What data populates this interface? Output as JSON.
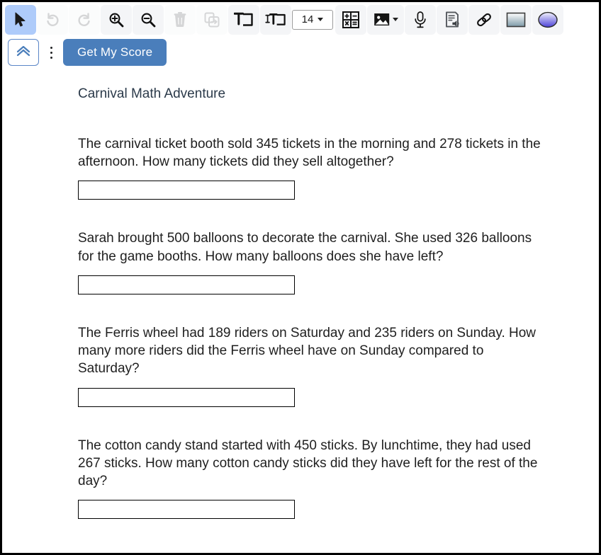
{
  "toolbar": {
    "buttons": [
      {
        "name": "select-tool",
        "icon": "cursor-arrow-icon",
        "label": "Select",
        "state": "active"
      },
      {
        "name": "undo-button",
        "icon": "undo-icon",
        "label": "Undo",
        "state": "disabled"
      },
      {
        "name": "redo-button",
        "icon": "redo-icon",
        "label": "Redo",
        "state": "disabled"
      },
      {
        "name": "zoom-in-button",
        "icon": "zoom-in-icon",
        "label": "Zoom In",
        "state": "enabled"
      },
      {
        "name": "zoom-out-button",
        "icon": "zoom-out-icon",
        "label": "Zoom Out",
        "state": "enabled"
      },
      {
        "name": "delete-button",
        "icon": "trash-icon",
        "label": "Delete",
        "state": "disabled"
      },
      {
        "name": "duplicate-button",
        "icon": "duplicate-icon",
        "label": "Duplicate",
        "state": "disabled"
      },
      {
        "name": "add-text-button",
        "icon": "text-box-icon",
        "label": "Add Text",
        "state": "enabled"
      },
      {
        "name": "text-style-button",
        "icon": "text-format-icon",
        "label": "Text Format",
        "state": "enabled"
      }
    ],
    "font_size_value": "14",
    "buttons_right": [
      {
        "name": "math-tool-button",
        "icon": "calculator-icon",
        "label": "Math",
        "state": "enabled"
      },
      {
        "name": "insert-image-button",
        "icon": "image-icon",
        "label": "Insert Image",
        "state": "enabled"
      },
      {
        "name": "microphone-button",
        "icon": "microphone-icon",
        "label": "Record Audio",
        "state": "enabled"
      },
      {
        "name": "read-aloud-button",
        "icon": "read-aloud-icon",
        "label": "Read Aloud",
        "state": "enabled"
      },
      {
        "name": "link-button",
        "icon": "link-icon",
        "label": "Insert Link",
        "state": "enabled"
      },
      {
        "name": "shape-rect-button",
        "icon": "rectangle-shape-icon",
        "label": "Rectangle",
        "state": "enabled"
      },
      {
        "name": "shape-ellipse-button",
        "icon": "ellipse-shape-icon",
        "label": "Ellipse",
        "state": "enabled"
      }
    ]
  },
  "subbar": {
    "collapse_icon": "double-chevron-up-icon",
    "more_options_icon": "kebab-menu-icon",
    "score_button_label": "Get My Score"
  },
  "document": {
    "title": "Carnival Math Adventure",
    "questions": [
      {
        "text": "The carnival ticket booth sold 345 tickets in the morning and 278 tickets in the afternoon. How many tickets did they sell altogether?",
        "answer": "",
        "placeholder": ""
      },
      {
        "text": "Sarah brought 500 balloons to decorate the carnival. She used 326 balloons for the game booths. How many balloons does she have left?",
        "answer": "",
        "placeholder": ""
      },
      {
        "text": "The Ferris wheel had 189 riders on Saturday and 235 riders on Sunday. How many more riders did the Ferris wheel have on Sunday compared to Saturday?",
        "answer": "",
        "placeholder": ""
      },
      {
        "text": "The cotton candy stand started with 450 sticks. By lunchtime, they had used 267 sticks. How many cotton candy sticks did they have left for the rest of the day?",
        "answer": "",
        "placeholder": ""
      }
    ]
  },
  "colors": {
    "accent_blue": "#4a7ebb",
    "active_tool_blue": "#aecbfa",
    "title_text": "#2b3a4a",
    "body_text": "#1f1f1f",
    "toolbar_button_bg": "#f4f5f7"
  }
}
